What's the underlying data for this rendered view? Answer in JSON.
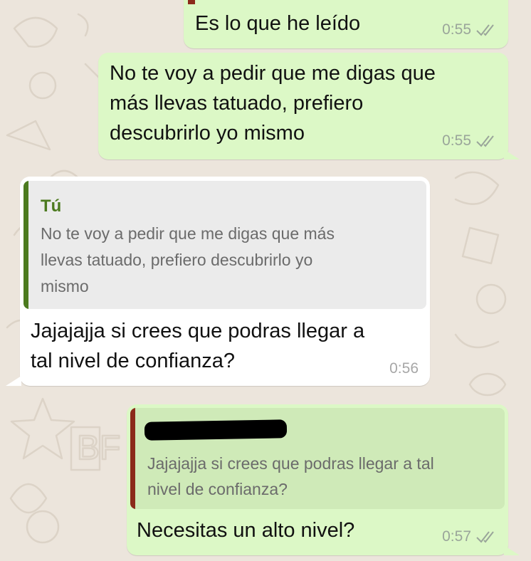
{
  "colors": {
    "chat_background": "#ece5dc",
    "outgoing_bubble": "#dcf8c6",
    "incoming_bubble": "#ffffff",
    "reply_bar_self": "#4c7a1f",
    "reply_author_self": "#4c7a1f",
    "reply_bar_other": "#8b2a1a",
    "read_ticks": "#9aa59a"
  },
  "messages": [
    {
      "direction": "outgoing",
      "text": "Es lo que he leído",
      "time": "0:55",
      "status_icon": "double-check-icon"
    },
    {
      "direction": "outgoing",
      "text_lines": [
        "No te voy a pedir que me digas que",
        "más llevas tatuado, prefiero",
        "descubrirlo yo mismo"
      ],
      "time": "0:55",
      "status_icon": "double-check-icon"
    },
    {
      "direction": "incoming",
      "reply": {
        "author": "Tú",
        "text_lines": [
          "No te voy a pedir que me digas que más",
          "llevas tatuado, prefiero descubrirlo yo",
          "mismo"
        ]
      },
      "text_lines": [
        "Jajajajja si crees que podras llegar a",
        "tal nivel de confianza?"
      ],
      "time": "0:56"
    },
    {
      "direction": "outgoing",
      "reply": {
        "author_redacted": true,
        "text_lines": [
          "Jajajajja si crees que podras llegar a tal",
          "nivel de confianza?"
        ]
      },
      "text": "Necesitas un alto nivel?",
      "time": "0:57",
      "status_icon": "double-check-icon"
    }
  ]
}
